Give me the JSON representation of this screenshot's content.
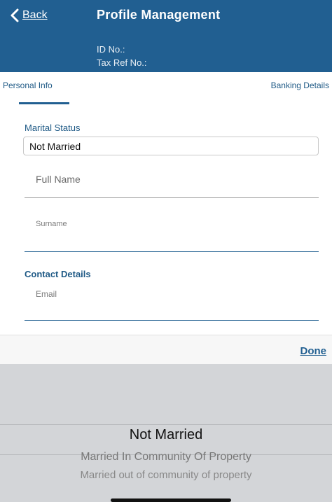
{
  "header": {
    "back_label": "Back",
    "title": "Profile Management",
    "id_label": "ID No.:",
    "tax_label": "Tax Ref No.:"
  },
  "tabs": [
    {
      "label": "Personal Info"
    },
    {
      "label": "Banking Details"
    }
  ],
  "form": {
    "marital_label": "Marital Status",
    "marital_value": "Not Married",
    "fullname_placeholder": "Full Name",
    "surname_placeholder": "Surname",
    "contact_label": "Contact Details",
    "email_placeholder": "Email"
  },
  "toolbar": {
    "done_label": "Done"
  },
  "picker": {
    "options": [
      "Not Married",
      "Married In Community Of Property",
      "Married out of community of property"
    ],
    "selected": "Not Married"
  },
  "colors": {
    "brand": "#215f91",
    "picker_bg": "#d3d5d8"
  }
}
